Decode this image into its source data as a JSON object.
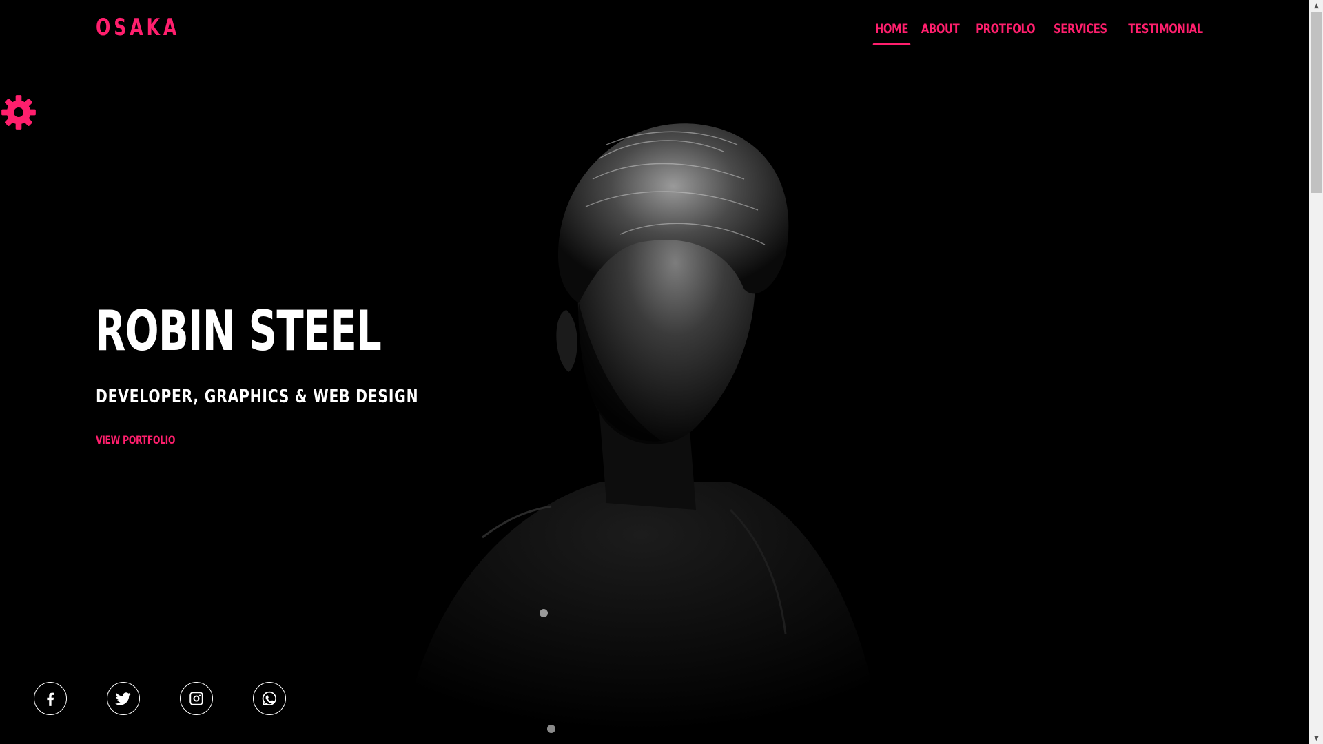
{
  "theme": {
    "accent": "#ff1f6d",
    "background": "#000000",
    "text": "#ffffff"
  },
  "header": {
    "logo": "OSAKA",
    "nav": [
      {
        "label": "HOME",
        "active": true
      },
      {
        "label": "ABOUT",
        "active": false
      },
      {
        "label": "PROTFOLO",
        "active": false
      },
      {
        "label": "SERVICES",
        "active": false
      },
      {
        "label": "TESTIMONIAL",
        "active": false
      }
    ]
  },
  "settings": {
    "icon": "gear-icon"
  },
  "hero": {
    "name": "ROBIN STEEL",
    "role": "DEVELOPER, GRAPHICS & WEB DESIGN",
    "cta": "VIEW PORTFOLIO"
  },
  "social": [
    {
      "name": "facebook",
      "icon": "facebook-icon"
    },
    {
      "name": "twitter",
      "icon": "twitter-icon"
    },
    {
      "name": "instagram",
      "icon": "instagram-icon"
    },
    {
      "name": "whatsapp",
      "icon": "whatsapp-icon"
    }
  ]
}
